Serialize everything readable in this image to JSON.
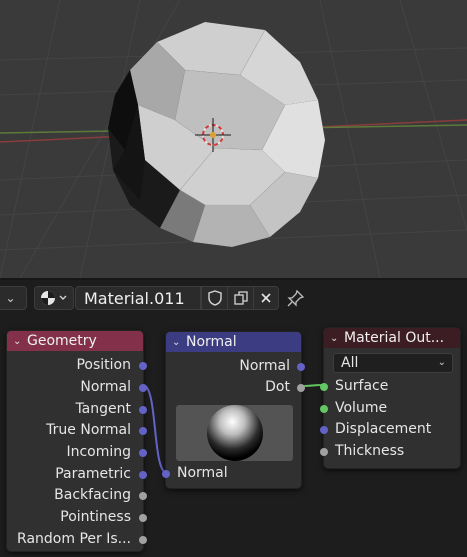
{
  "viewport": {
    "object": "icosphere",
    "background_color": "#3a3a3a"
  },
  "header": {
    "material_name": "Material.011",
    "left_dropdown_icon": "chevron-down-icon",
    "shading_icon": "material-sphere-icon",
    "fake_user_icon": "shield-icon",
    "duplicate_icon": "duplicate-icon",
    "unlink_icon": "close-icon",
    "pin_icon": "pin-icon"
  },
  "nodes": {
    "geometry": {
      "title": "Geometry",
      "color": "#83314a",
      "outputs": [
        {
          "label": "Position",
          "socket": "vector"
        },
        {
          "label": "Normal",
          "socket": "vector"
        },
        {
          "label": "Tangent",
          "socket": "vector"
        },
        {
          "label": "True Normal",
          "socket": "vector"
        },
        {
          "label": "Incoming",
          "socket": "vector"
        },
        {
          "label": "Parametric",
          "socket": "vector"
        },
        {
          "label": "Backfacing",
          "socket": "float"
        },
        {
          "label": "Pointiness",
          "socket": "float"
        },
        {
          "label": "Random Per Is...",
          "socket": "float"
        }
      ]
    },
    "normal": {
      "title": "Normal",
      "color": "#3c3c83",
      "outputs": [
        {
          "label": "Normal",
          "socket": "vector"
        },
        {
          "label": "Dot",
          "socket": "float"
        }
      ],
      "inputs": [
        {
          "label": "Normal",
          "socket": "vector"
        }
      ]
    },
    "material_output": {
      "title": "Material Out...",
      "color": "#3c1d24",
      "target": "All",
      "inputs": [
        {
          "label": "Surface",
          "socket": "shader"
        },
        {
          "label": "Volume",
          "socket": "shader"
        },
        {
          "label": "Displacement",
          "socket": "vector"
        },
        {
          "label": "Thickness",
          "socket": "float"
        }
      ]
    }
  },
  "links": [
    {
      "from": "Geometry.Normal",
      "to": "Normal.Normal"
    },
    {
      "from": "Normal.Dot",
      "to": "Material Output.Surface"
    }
  ]
}
